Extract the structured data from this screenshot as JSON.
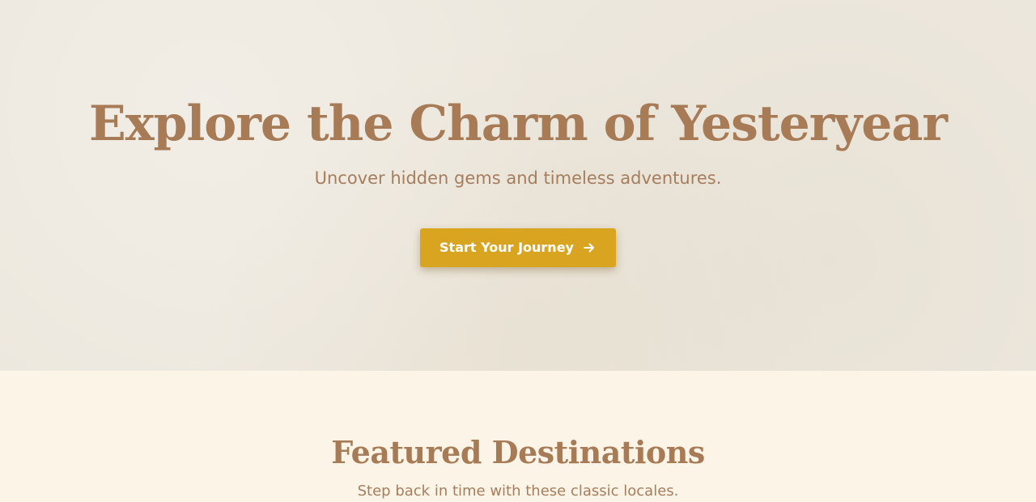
{
  "hero": {
    "title": "Explore the Charm of Yesteryear",
    "subtitle": "Uncover hidden gems and timeless adventures.",
    "cta_label": "Start Your Journey",
    "cta_icon": "arrow-right-icon"
  },
  "featured": {
    "title": "Featured Destinations",
    "subtitle": "Step back in time with these classic locales."
  },
  "colors": {
    "hero_background": "#ede8de",
    "section_background": "#fcf5e7",
    "heading": "#a87b57",
    "body_text": "#a67d5d",
    "accent": "#d9a521",
    "button_text": "#ffffff"
  }
}
